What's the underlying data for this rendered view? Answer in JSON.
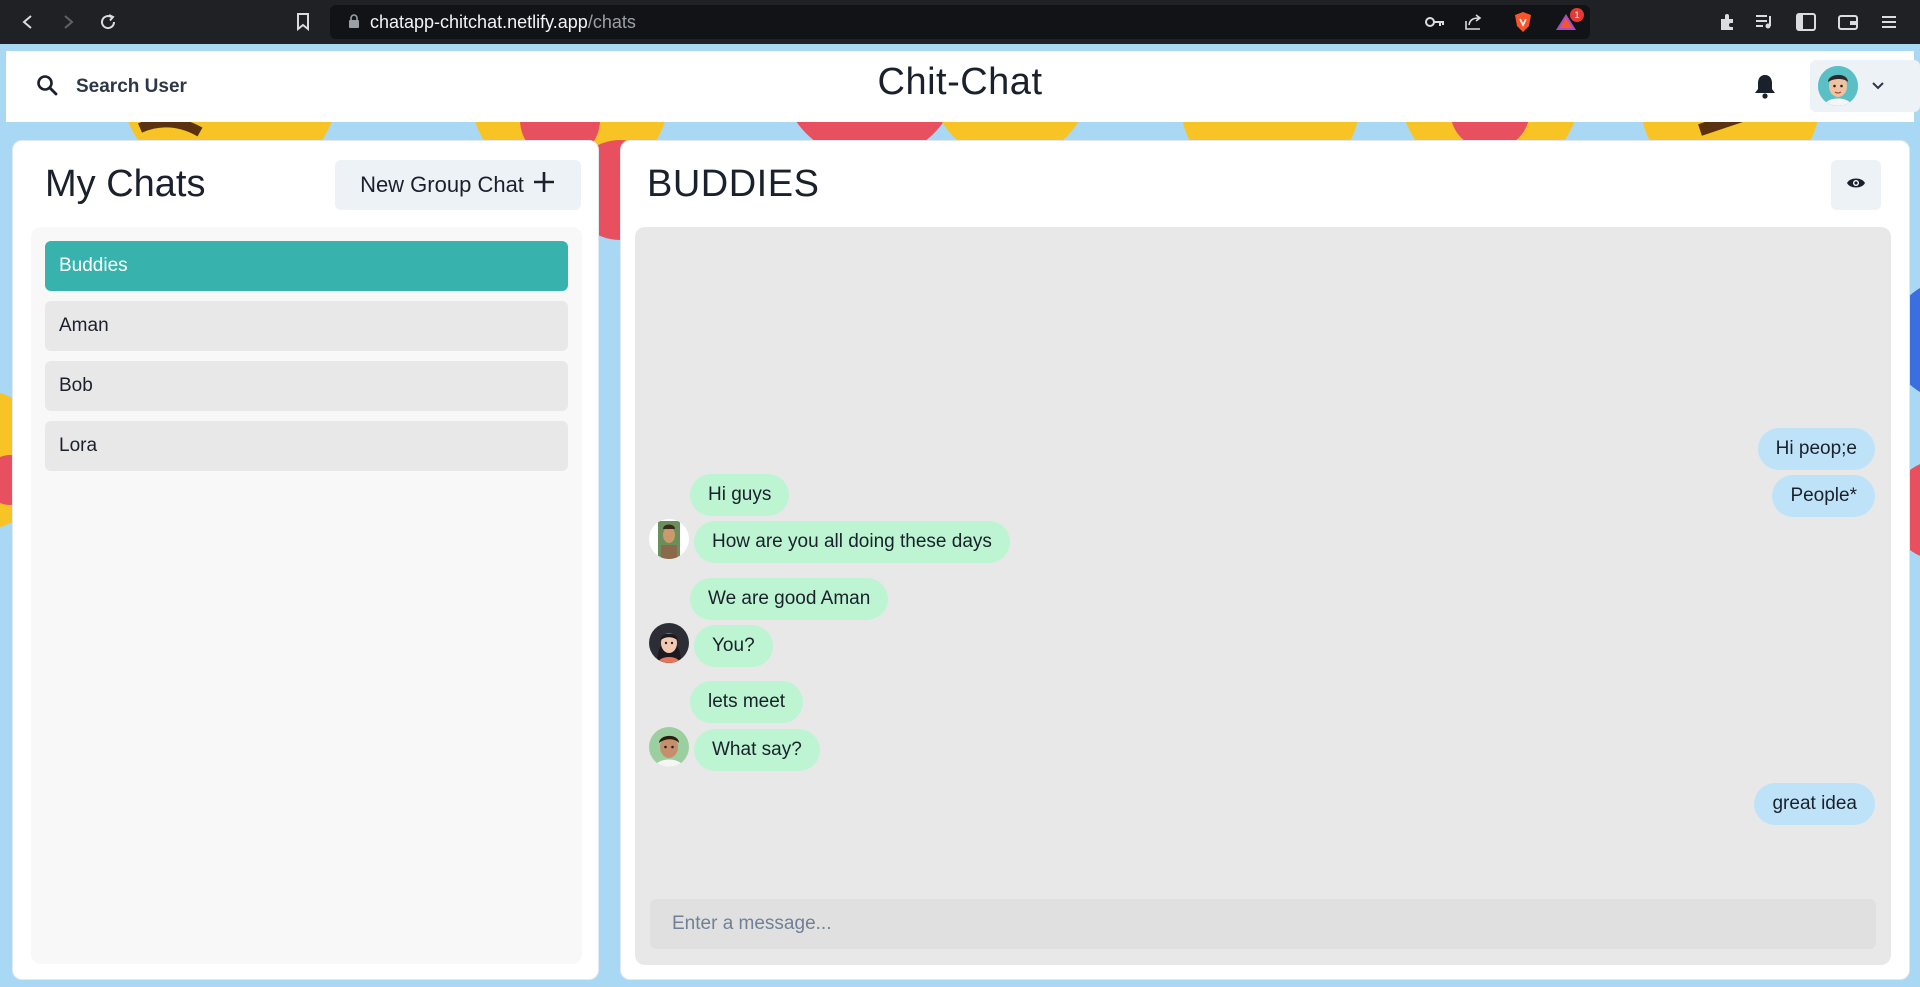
{
  "browser": {
    "url_host": "chatapp-chitchat.netlify.app",
    "url_path": "/chats",
    "extension_badge": "1"
  },
  "header": {
    "search_label": "Search User",
    "app_title": "Chit-Chat"
  },
  "sidebar": {
    "title": "My Chats",
    "new_group_label": "New Group Chat",
    "chats": [
      {
        "name": "Buddies",
        "active": true
      },
      {
        "name": "Aman",
        "active": false
      },
      {
        "name": "Bob",
        "active": false
      },
      {
        "name": "Lora",
        "active": false
      }
    ]
  },
  "chat": {
    "title": "BUDDIES",
    "messages": [
      {
        "text": "Hi peop;e",
        "mine": true
      },
      {
        "text": "People*",
        "mine": true
      },
      {
        "text": "Hi guys",
        "mine": false
      },
      {
        "text": "How are you all doing these days",
        "mine": false
      },
      {
        "text": "We are good Aman",
        "mine": false
      },
      {
        "text": "You?",
        "mine": false
      },
      {
        "text": "lets meet",
        "mine": false
      },
      {
        "text": "What say?",
        "mine": false
      },
      {
        "text": "great idea",
        "mine": true
      }
    ],
    "input_placeholder": "Enter a message..."
  },
  "colors": {
    "accent": "#38b2ac",
    "my_bubble": "#bee3f8",
    "their_bubble": "#bdf5d2",
    "page_bg": "#a9d8f5"
  }
}
